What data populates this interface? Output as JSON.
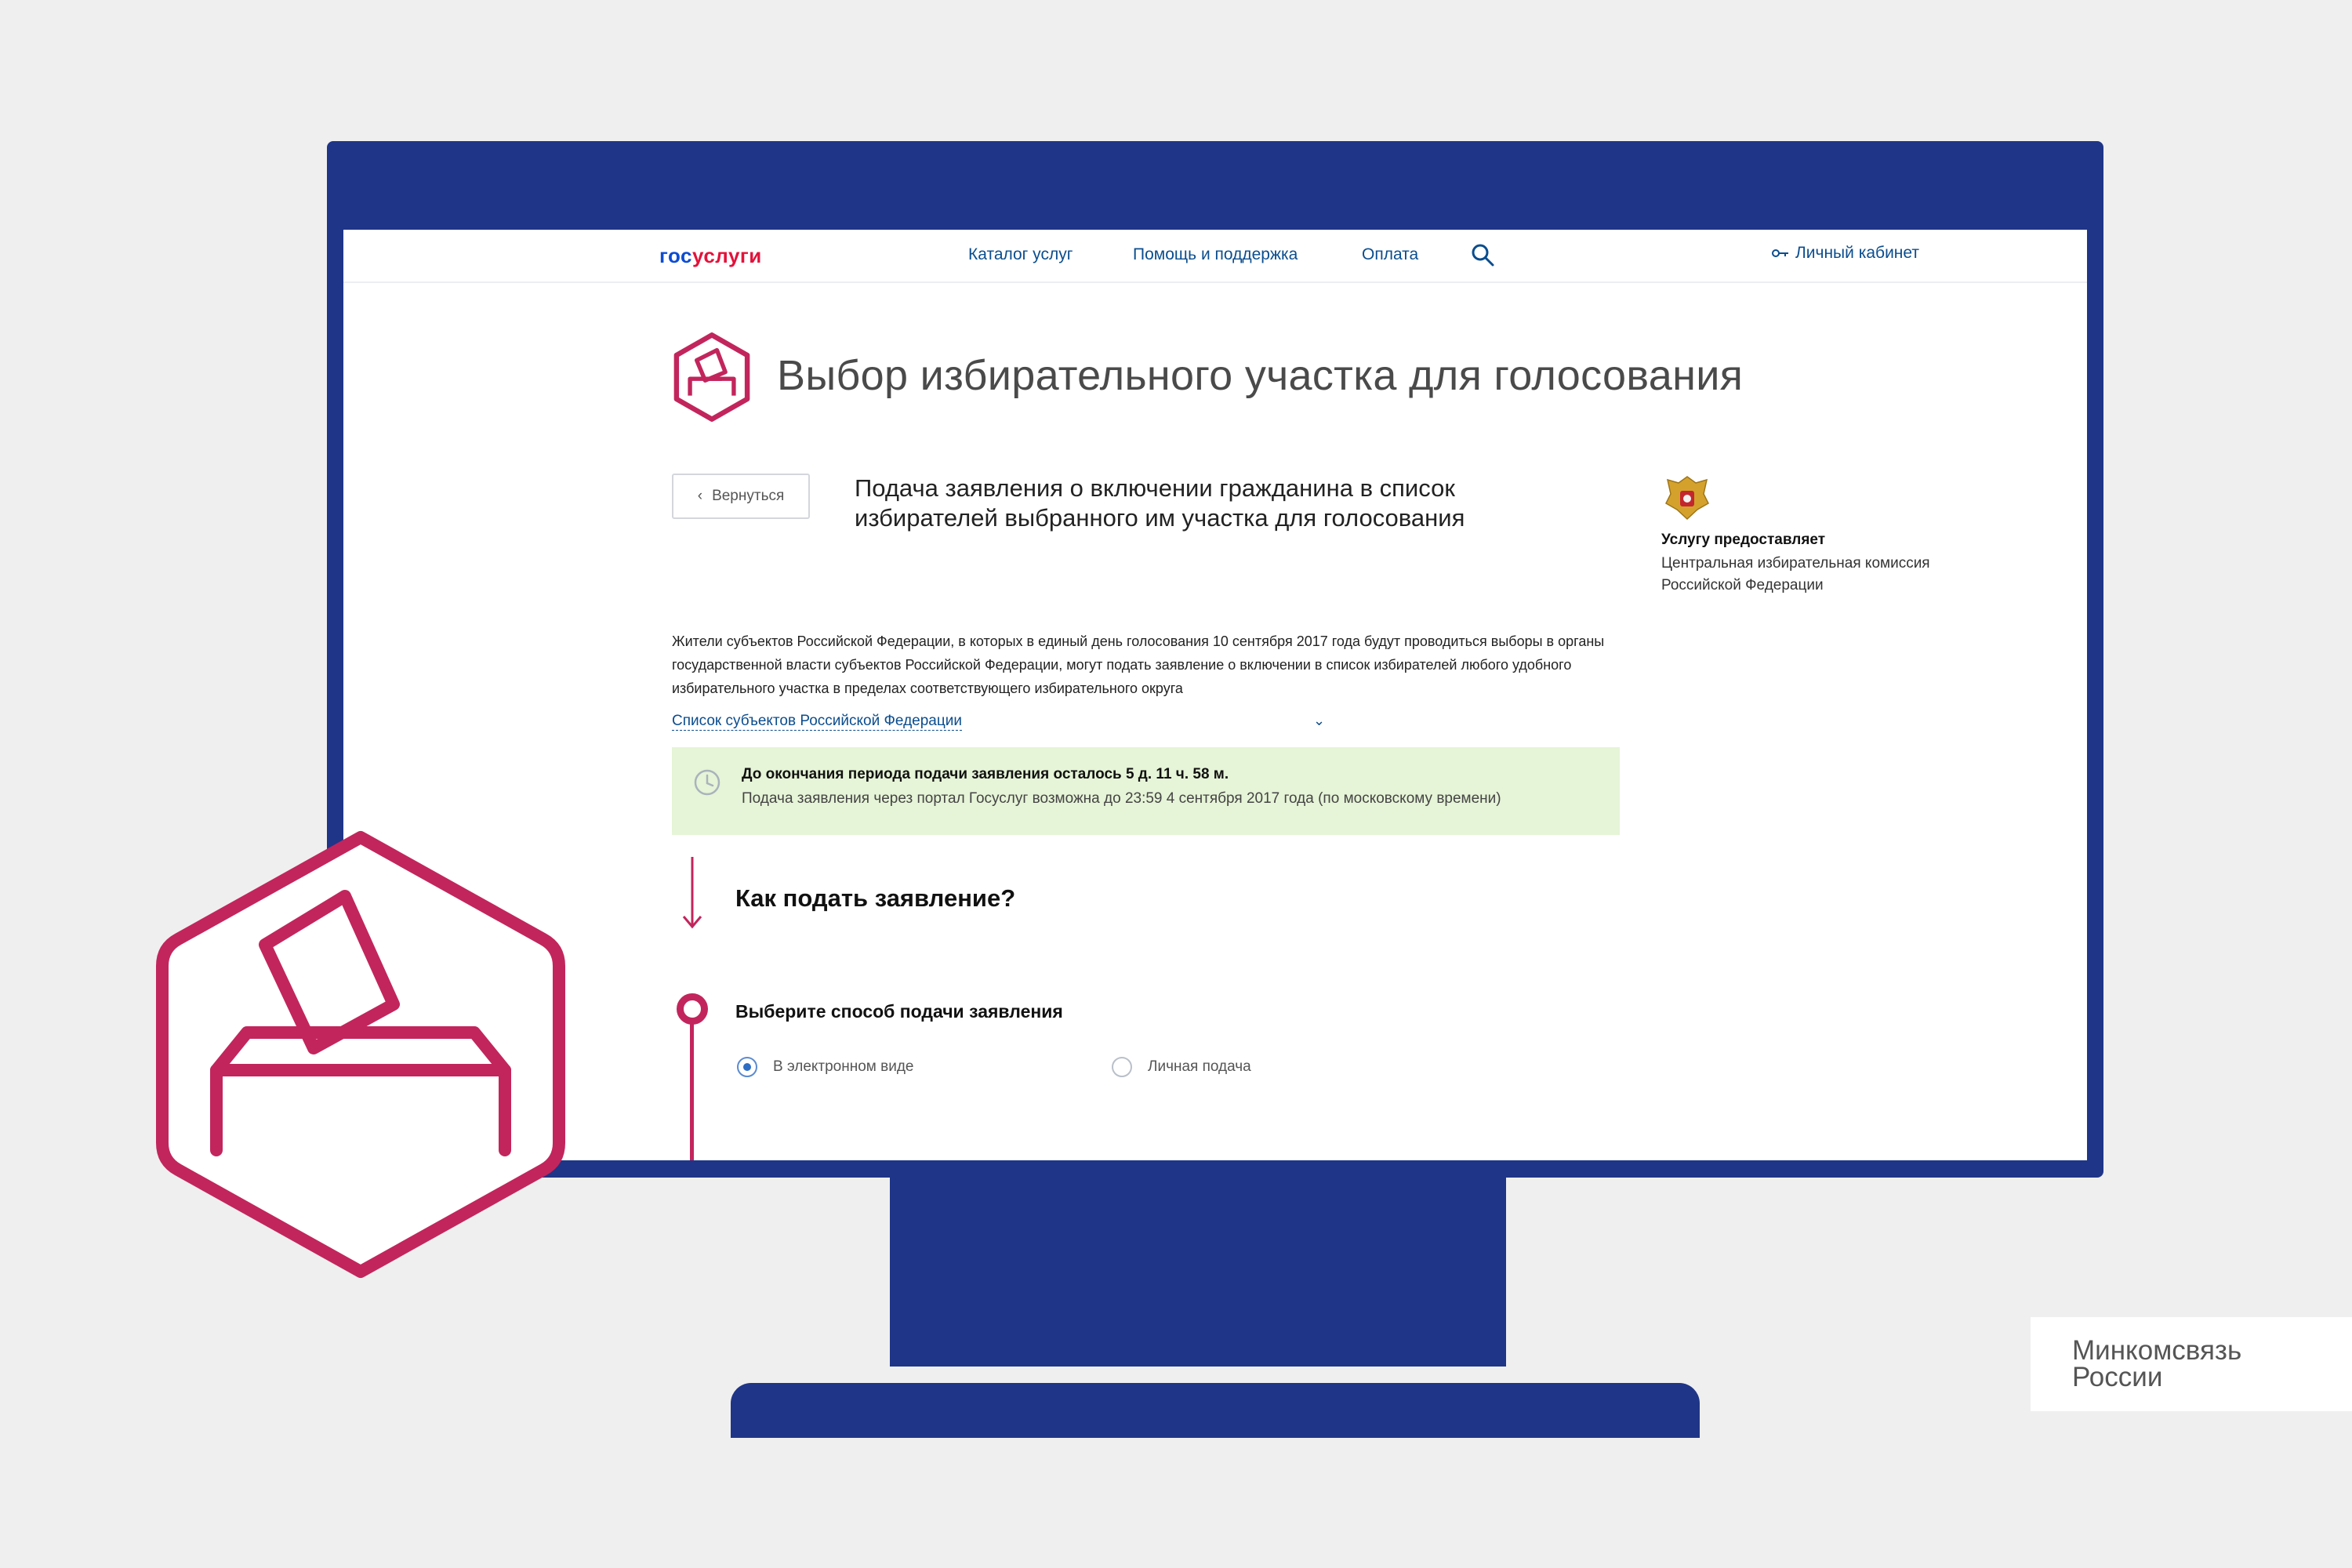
{
  "header": {
    "logo_prefix": "гос",
    "logo_suffix": "услуги",
    "nav": [
      "Каталог услуг",
      "Помощь и поддержка",
      "Оплата"
    ],
    "cabinet_label": "Личный кабинет"
  },
  "page": {
    "title": "Выбор избирательного участка для голосования",
    "back_label": "Вернуться",
    "service_title": "Подача заявления о включении гражданина в список избирателей выбранного им участка для голосования"
  },
  "provider": {
    "label": "Услугу предоставляет",
    "name": "Центральная избирательная комиссия Российской Федерации"
  },
  "intro": {
    "text": "Жители субъектов Российской Федерации, в которых в единый день голосования 10 сентября 2017 года будут проводиться выборы в органы государственной власти субъектов Российской Федерации, могут подать заявление о включении в список избирателей любого удобного избирательного участка в пределах соответствующего избирательного округа",
    "regions_link": "Список субъектов Российской Федерации"
  },
  "notice": {
    "main": "До окончания периода подачи заявления осталось 5 д. 11 ч. 58 м.",
    "sub": "Подача заявления через портал Госуслуг возможна до 23:59 4 сентября 2017 года (по московскому времени)"
  },
  "how": {
    "title": "Как подать заявление?",
    "step_title": "Выберите способ подачи заявления",
    "options": [
      {
        "label": "В электронном виде",
        "checked": true
      },
      {
        "label": "Личная подача",
        "checked": false
      }
    ]
  },
  "brand": {
    "line1": "Минкомсвязь",
    "line2": "России"
  },
  "colors": {
    "monitor": "#1f3587",
    "accent": "#c2255c",
    "link": "#0b4d8e",
    "notice_bg": "#e6f4d7"
  },
  "icons": [
    "search-icon",
    "key-icon",
    "ballot-box-icon",
    "chevron-left-icon",
    "chevron-down-icon",
    "clock-icon",
    "coat-of-arms-icon",
    "arrow-down-icon"
  ]
}
